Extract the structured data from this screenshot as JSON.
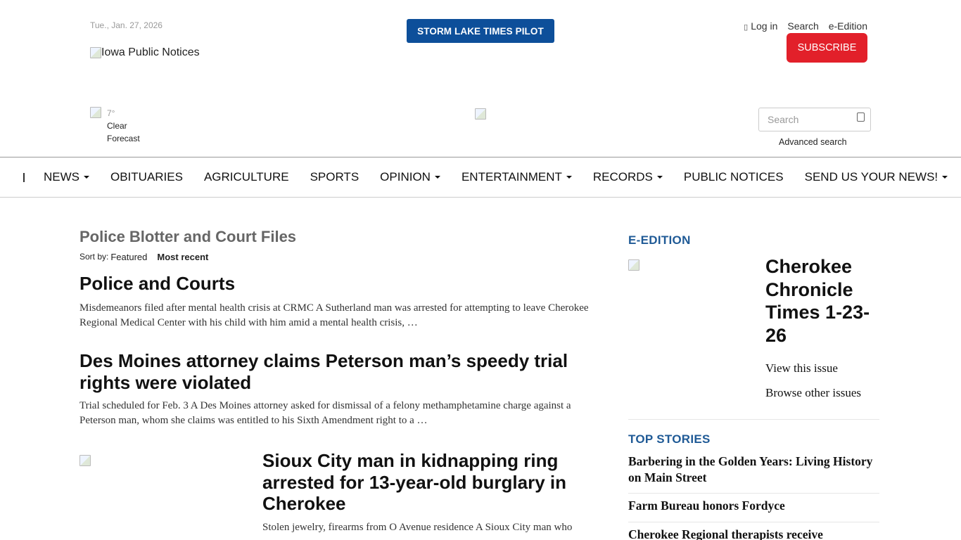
{
  "header": {
    "date": "Tue., Jan. 27, 2026",
    "logo_alt": "Iowa Public Notices",
    "brand_button": "STORM LAKE TIMES PILOT",
    "login": "Log in",
    "search": "Search",
    "eedition": "e-Edition",
    "subscribe": "SUBSCRIBE",
    "subscribe_color": "#e2202a",
    "brand_color": "#0d4f9a"
  },
  "weather": {
    "temp": "7°",
    "condition": "Clear",
    "forecast": "Forecast"
  },
  "search_box": {
    "placeholder": "Search",
    "advanced": "Advanced search"
  },
  "nav": {
    "items": [
      {
        "label": "NEWS",
        "dropdown": true
      },
      {
        "label": "OBITUARIES",
        "dropdown": false
      },
      {
        "label": "AGRICULTURE",
        "dropdown": false
      },
      {
        "label": "SPORTS",
        "dropdown": false
      },
      {
        "label": "OPINION",
        "dropdown": true
      },
      {
        "label": "ENTERTAINMENT",
        "dropdown": true
      },
      {
        "label": "RECORDS",
        "dropdown": true
      },
      {
        "label": "PUBLIC NOTICES",
        "dropdown": false
      },
      {
        "label": "SEND US YOUR NEWS!",
        "dropdown": true
      }
    ]
  },
  "main": {
    "section_title": "Police Blotter and Court Files",
    "sort_label": "Sort by:",
    "sort_featured": "Featured",
    "sort_recent": "Most recent",
    "articles": [
      {
        "headline": "Police and Courts",
        "summary": "Misdemeanors filed after mental health crisis at CRMC A Sutherland man was arrested for attempting to leave Cherokee Regional Medical Center with his child with him amid a mental health crisis, …"
      },
      {
        "headline": "Des Moines attorney claims Peterson man’s speedy trial rights were violated",
        "summary": "Trial scheduled for Feb. 3 A Des Moines attorney asked for dismissal of a felony methamphetamine charge against a Peterson man, whom she claims was entitled to his Sixth Amendment right to a …"
      },
      {
        "headline": "Sioux City man in kidnapping ring arrested for 13-year-old burglary in Cherokee",
        "summary": "Stolen jewelry, firearms from O Avenue residence A Sioux City man who"
      }
    ]
  },
  "sidebar": {
    "edition_heading": "E-EDITION",
    "edition_title": "Cherokee Chronicle Times 1-23-26",
    "view_issue": "View this issue",
    "browse_issues": "Browse other issues",
    "top_heading": "TOP STORIES",
    "heading_color": "#1f5a96",
    "stories": [
      "Barbering in the Golden Years: Living History on Main Street",
      "Farm Bureau honors Fordyce",
      "Cherokee Regional therapists receive"
    ]
  }
}
